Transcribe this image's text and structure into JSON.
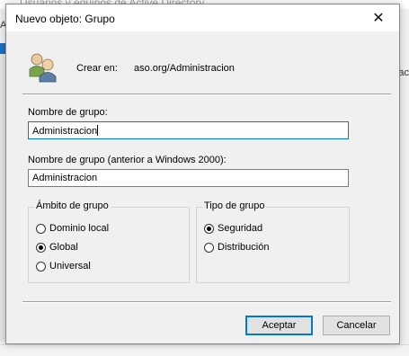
{
  "background": {
    "window_title": "Usuarios y equipos de Active Directory",
    "menu_letter": "A",
    "right_text": "ac"
  },
  "dialog": {
    "title": "Nuevo objeto: Grupo",
    "close_symbol": "✕",
    "create_in_label": "Crear en:",
    "create_in_path": "aso.org/Administracion",
    "group_name_label": "Nombre de grupo:",
    "group_name_value": "Administracion",
    "pre2000_label": "Nombre de grupo (anterior a Windows 2000):",
    "pre2000_value": "Administracion",
    "scope": {
      "title": "Ámbito de grupo",
      "options": [
        "Dominio local",
        "Global",
        "Universal"
      ],
      "selected": "Global"
    },
    "type": {
      "title": "Tipo de grupo",
      "options": [
        "Seguridad",
        "Distribución"
      ],
      "selected": "Seguridad"
    },
    "ok_button": "Aceptar",
    "cancel_button": "Cancelar",
    "accent_color": "#0078d7"
  }
}
